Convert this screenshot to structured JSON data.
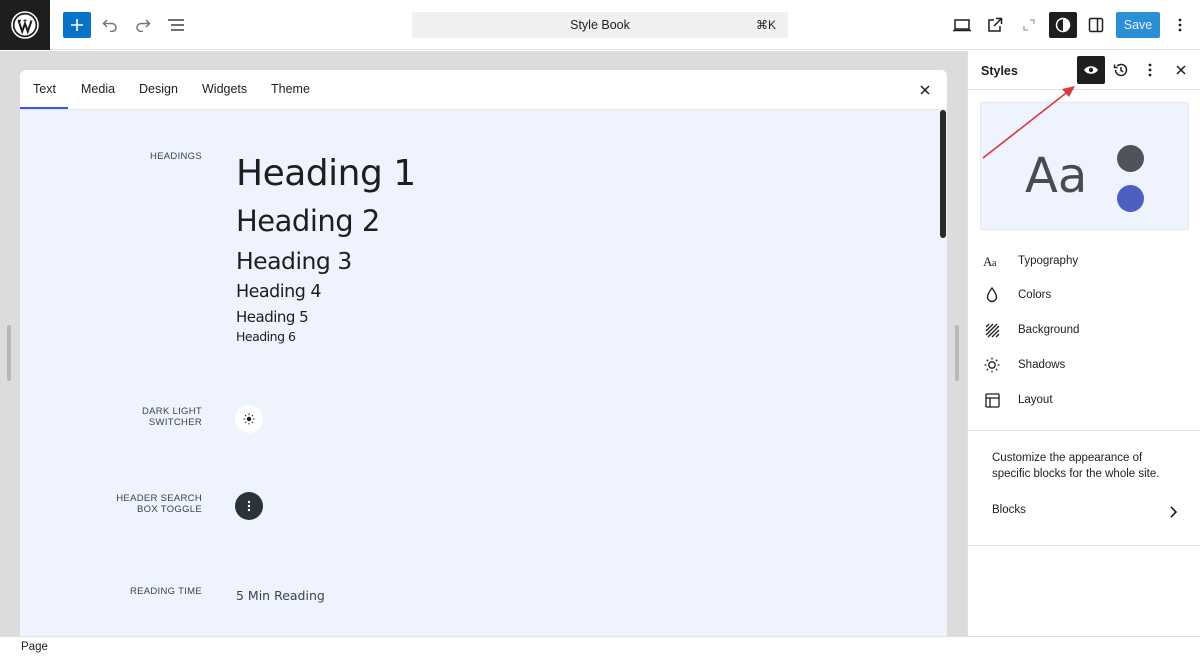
{
  "toolbar": {
    "logo_icon": "wordpress-logo",
    "add_icon": "plus-icon",
    "undo_icon": "undo-icon",
    "redo_icon": "redo-icon",
    "list_view_icon": "list-view-icon",
    "command_title": "Style Book",
    "command_shortcut": "⌘K",
    "view_icon": "desktop-icon",
    "external_icon": "external-link-icon",
    "zoom_icon": "zoom-out-icon",
    "styles_icon": "contrast-icon",
    "settings_icon": "sidebar-icon",
    "save_label": "Save",
    "options_icon": "more-vertical-icon",
    "accent_color": "#0873c8"
  },
  "stylebook": {
    "tabs": [
      "Text",
      "Media",
      "Design",
      "Widgets",
      "Theme"
    ],
    "active_tab": "Text",
    "close_icon": "close-icon",
    "sections": {
      "headings_label": "HEADINGS",
      "headings": [
        "Heading 1",
        "Heading 2",
        "Heading 3",
        "Heading 4",
        "Heading 5",
        "Heading 6"
      ],
      "switcher_label_1": "DARK LIGHT",
      "switcher_label_2": "SWITCHER",
      "switcher_icon": "sun-icon",
      "search_label_1": "HEADER SEARCH",
      "search_label_2": "BOX TOGGLE",
      "search_icon": "more-vertical-icon",
      "reading_label": "READING TIME",
      "reading_value": "5 Min Reading"
    }
  },
  "sidebar": {
    "title": "Styles",
    "header_icons": [
      "eye-icon",
      "revisions-icon",
      "more-vertical-icon",
      "close-icon"
    ],
    "preview": {
      "text": "Aa",
      "colors": [
        "#50535a",
        "#4d5fc0"
      ],
      "background": "#eef3fe"
    },
    "menu": [
      {
        "label": "Typography",
        "icon": "typography-icon"
      },
      {
        "label": "Colors",
        "icon": "droplet-icon"
      },
      {
        "label": "Background",
        "icon": "background-icon"
      },
      {
        "label": "Shadows",
        "icon": "shadow-icon"
      },
      {
        "label": "Layout",
        "icon": "layout-icon"
      }
    ],
    "description": "Customize the appearance of specific blocks for the whole site.",
    "blocks_label": "Blocks"
  },
  "footer": {
    "breadcrumb": "Page"
  }
}
